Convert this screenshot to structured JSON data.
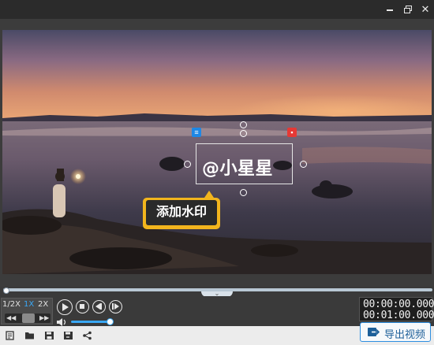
{
  "window": {
    "controls": [
      "minimize-icon",
      "restore-icon",
      "close-icon"
    ],
    "close_glyph": "✕"
  },
  "watermark": {
    "text": "@小星星",
    "edit_icon": "list-icon",
    "delete_icon": "trash-icon"
  },
  "callout": {
    "text": "添加水印",
    "color": "#f2b51d"
  },
  "timeline": {
    "progress": 0.0,
    "collapse_glyph": "⌄"
  },
  "playback": {
    "speeds": [
      "1/2X",
      "1X",
      "2X"
    ],
    "active_speed": "1X",
    "speed_left_arrow": "◀◀",
    "speed_right_arrow": "▶▶",
    "volume": 0.95
  },
  "timecode": {
    "current": "00:00:00.000",
    "total": "00:01:00.000"
  },
  "bottombar": {
    "icons": [
      "new-file-icon",
      "open-folder-icon",
      "save-icon",
      "save-as-icon",
      "share-icon"
    ]
  },
  "export": {
    "label": "导出视频",
    "accent": "#2f8fe0"
  }
}
